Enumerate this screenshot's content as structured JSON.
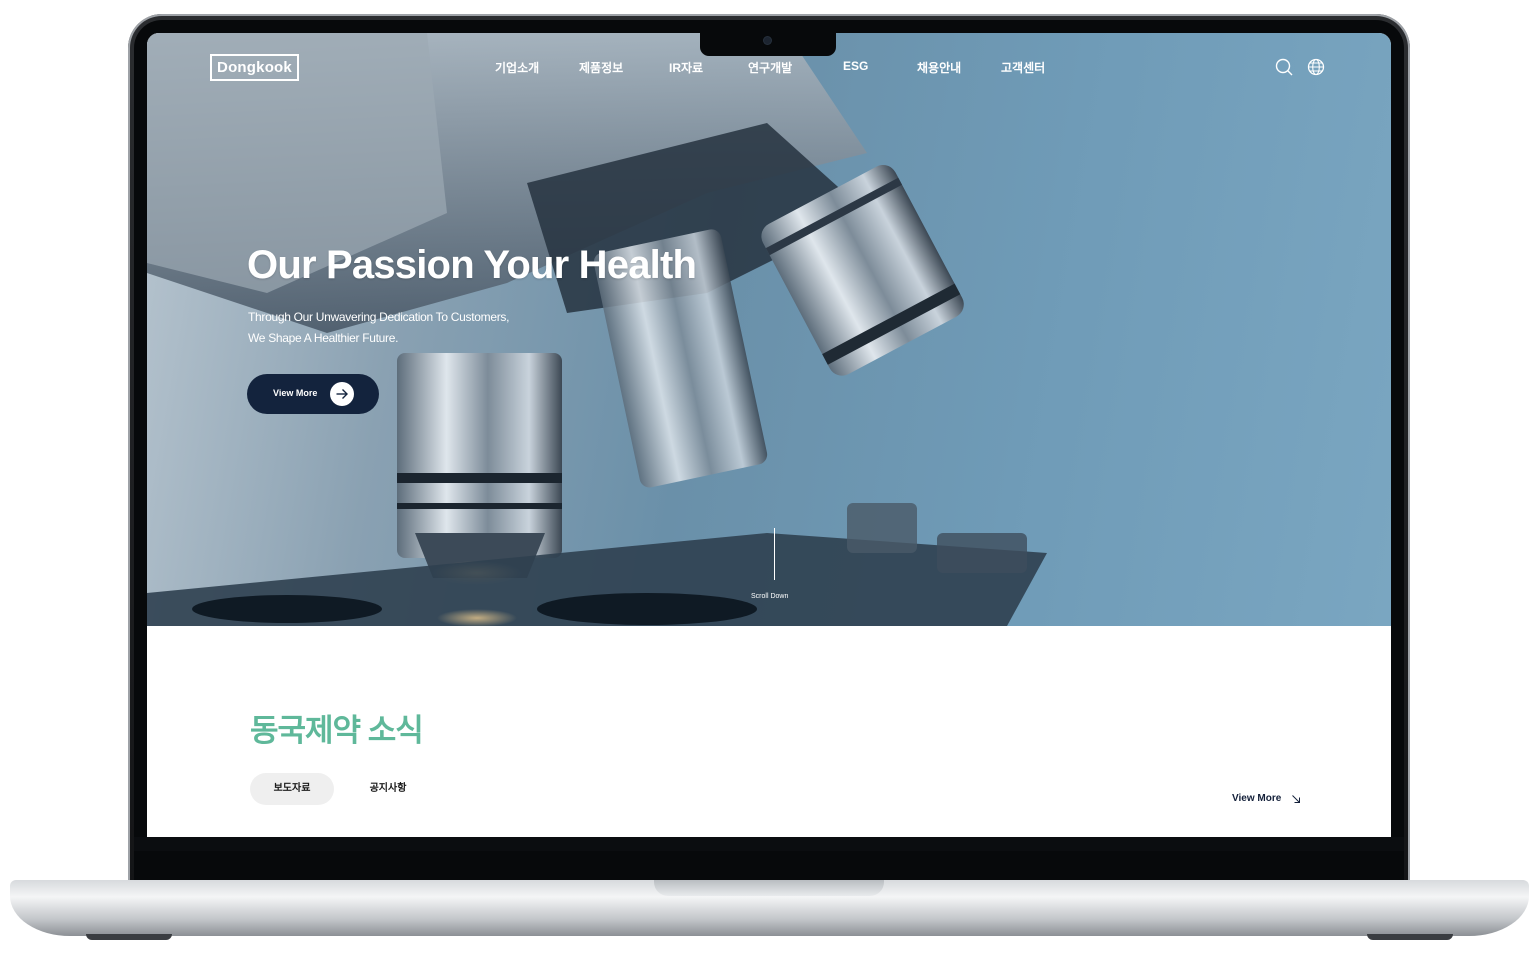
{
  "brand": {
    "logo_text": "Dongkook"
  },
  "nav": {
    "items": [
      "기업소개",
      "제품정보",
      "IR자료",
      "연구개발",
      "ESG",
      "채용안내",
      "고객센터"
    ],
    "icons": [
      "search-icon",
      "globe-icon"
    ]
  },
  "hero": {
    "headline": "Our Passion Your Health",
    "subline_1": "Through Our Unwavering Dedication To Customers,",
    "subline_2": "We Shape A Healthier Future.",
    "cta_label": "View More",
    "cta_icon": "arrow-right-icon",
    "scroll_label": "Scroll Down"
  },
  "news": {
    "title": "동국제약 소식",
    "tabs": [
      {
        "label": "보도자료",
        "active": true
      },
      {
        "label": "공지사항",
        "active": false
      }
    ],
    "more_label": "View More",
    "more_icon": "arrow-down-right-icon"
  },
  "colors": {
    "accent_green": "#5fb89a",
    "cta_navy": "#13233d",
    "hero_blue": "#6f9bb7"
  }
}
